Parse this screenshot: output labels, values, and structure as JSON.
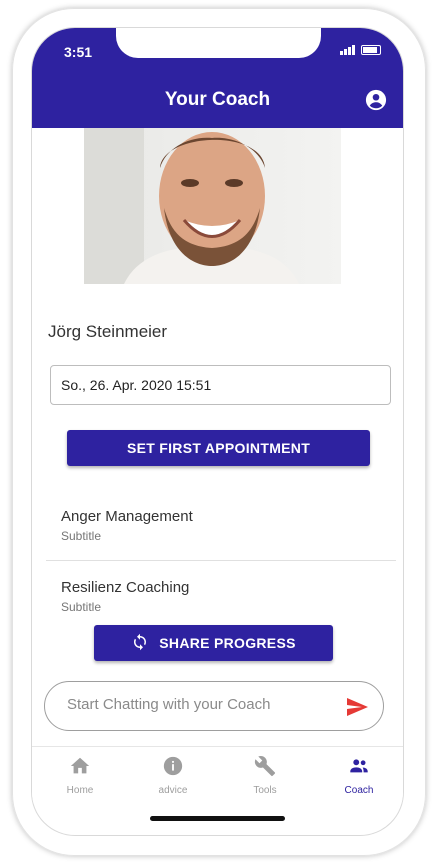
{
  "status_bar": {
    "time": "3:51"
  },
  "header": {
    "title": "Your Coach",
    "account_icon": "account-circle-icon"
  },
  "coach": {
    "name": "Jörg Steinmeier"
  },
  "appointment": {
    "date_value": "So., 26. Apr. 2020 15:51",
    "button_label": "SET FIRST APPOINTMENT"
  },
  "programs": [
    {
      "title": "Anger Management",
      "subtitle": "Subtitle"
    },
    {
      "title": "Resilienz Coaching",
      "subtitle": "Subtitle"
    }
  ],
  "share": {
    "label": "SHARE PROGRESS",
    "icon": "sync-icon"
  },
  "chat": {
    "placeholder": "Start Chatting with your Coach",
    "send_icon": "send-icon"
  },
  "nav": [
    {
      "label": "Home",
      "icon": "home-icon",
      "active": false
    },
    {
      "label": "advice",
      "icon": "info-icon",
      "active": false
    },
    {
      "label": "Tools",
      "icon": "wrench-icon",
      "active": false
    },
    {
      "label": "Coach",
      "icon": "people-icon",
      "active": true
    }
  ],
  "colors": {
    "primary": "#2e22a0",
    "send_accent": "#e53935",
    "inactive_nav": "#9e9e9e"
  }
}
